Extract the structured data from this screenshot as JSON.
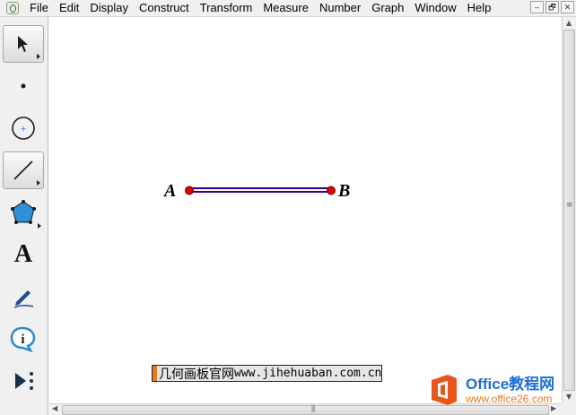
{
  "menu": {
    "items": [
      "File",
      "Edit",
      "Display",
      "Construct",
      "Transform",
      "Measure",
      "Number",
      "Graph",
      "Window",
      "Help"
    ]
  },
  "window_buttons": {
    "minimize": "–",
    "restore": "🗗",
    "close": "✕"
  },
  "toolbox": {
    "tools": [
      {
        "name": "selection-arrow-tool",
        "icon": "arrow-cursor-icon",
        "selected": true
      },
      {
        "name": "point-tool",
        "icon": "point-icon",
        "selected": false
      },
      {
        "name": "compass-tool",
        "icon": "circle-icon",
        "selected": false
      },
      {
        "name": "straightedge-tool",
        "icon": "segment-icon",
        "selected": true
      },
      {
        "name": "polygon-tool",
        "icon": "pentagon-icon",
        "selected": false
      },
      {
        "name": "text-tool",
        "icon": "text-a-icon",
        "label": "A",
        "selected": false
      },
      {
        "name": "marker-tool",
        "icon": "pen-icon",
        "selected": false
      },
      {
        "name": "information-tool",
        "icon": "info-icon",
        "selected": false
      },
      {
        "name": "custom-tool",
        "icon": "play-dots-icon",
        "selected": false
      }
    ]
  },
  "canvas": {
    "points": [
      {
        "label": "A",
        "color": "#e00000"
      },
      {
        "label": "B",
        "color": "#e00000"
      }
    ],
    "segment_color": "#2a00a0"
  },
  "caption": {
    "chinese": "几何画板官网",
    "url": "www.jihehuaban.com.cn"
  },
  "watermark": {
    "title": "Office教程网",
    "url": "www.office26.com"
  },
  "colors": {
    "accent_orange": "#e87a1d",
    "watermark_blue": "#1c6ed4",
    "point_red": "#e00000"
  }
}
